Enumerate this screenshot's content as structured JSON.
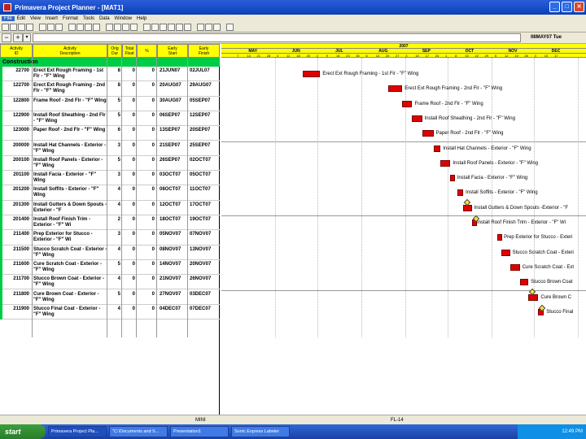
{
  "window": {
    "title": "Primavera Project Planner - [MAT1]",
    "min": "_",
    "max": "□",
    "close": "✕"
  },
  "menu": [
    "File",
    "Edit",
    "View",
    "Insert",
    "Format",
    "Tools",
    "Data",
    "Window",
    "Help"
  ],
  "editbar": {
    "minus": "−",
    "plus": "+",
    "arrow": "▾",
    "date": "08MAY07 Tue"
  },
  "columns": [
    {
      "label": "Activity\nID"
    },
    {
      "label": "Activity\nDescription"
    },
    {
      "label": "Orig\nDur"
    },
    {
      "label": "Total\nFloat"
    },
    {
      "label": "%"
    },
    {
      "label": "Early\nStart"
    },
    {
      "label": "Early\nFinish"
    }
  ],
  "wbs_group": "Construction",
  "activities": [
    {
      "id": "22700",
      "desc": "Erect Ext Rough Framing - 1st Flr - \"F\" Wing",
      "dur": "8",
      "tf": "0",
      "pct": "0",
      "es": "21JUN07",
      "ef": "02JUL07",
      "bar_label": "Erect Ext Rough Framing - 1st Flr - \"F\" Wing"
    },
    {
      "id": "122700",
      "desc": "Erect Ext Rough Framing - 2nd Flr - \"F\" Wing",
      "dur": "8",
      "tf": "0",
      "pct": "0",
      "es": "20AUG07",
      "ef": "29AUG07",
      "bar_label": "Erect Ext Rough Framing - 2nd Flr - \"F\" Wing"
    },
    {
      "id": "122800",
      "desc": "Frame Roof - 2nd Flr - \"F\" Wing",
      "dur": "5",
      "tf": "0",
      "pct": "0",
      "es": "30AUG07",
      "ef": "05SEP07",
      "bar_label": "Frame Roof - 2nd Flr - \"F\" Wing"
    },
    {
      "id": "122900",
      "desc": "Install Roof Sheathing - 2nd Flr - \"F\" Wing",
      "dur": "5",
      "tf": "0",
      "pct": "0",
      "es": "06SEP07",
      "ef": "12SEP07",
      "bar_label": "Install Roof Sheathing - 2nd Flr - \"F\" Wing"
    },
    {
      "id": "123000",
      "desc": "Paper Roof - 2nd Flr - \"F\" Wing",
      "dur": "6",
      "tf": "0",
      "pct": "0",
      "es": "13SEP07",
      "ef": "20SEP07",
      "bar_label": "Paper Roof - 2nd Flr - \"F\" Wing"
    },
    {
      "id": "200000",
      "desc": "Install Hat Channels - Exterior - \"F\" Wing",
      "dur": "3",
      "tf": "0",
      "pct": "0",
      "es": "21SEP07",
      "ef": "25SEP07",
      "bar_label": "Install Hat Channels - Exterior - \"F\" Wing"
    },
    {
      "id": "200100",
      "desc": "Install Roof Panels - Exterior - \"F\" Wing",
      "dur": "5",
      "tf": "0",
      "pct": "0",
      "es": "26SEP07",
      "ef": "02OCT07",
      "bar_label": "Install Roof Panels - Exterior - \"F\" Wing"
    },
    {
      "id": "201100",
      "desc": "Install Facia - Exterior - \"F\" Wing",
      "dur": "3",
      "tf": "0",
      "pct": "0",
      "es": "03OCT07",
      "ef": "05OCT07",
      "bar_label": "Install Facia - Exterior - \"F\" Wing"
    },
    {
      "id": "201200",
      "desc": "Install Soffits - Exterior - \"F\" Wing",
      "dur": "4",
      "tf": "0",
      "pct": "0",
      "es": "08OCT07",
      "ef": "11OCT07",
      "bar_label": "Install Soffits - Exterior - \"F\" Wing"
    },
    {
      "id": "201300",
      "desc": "Install Gutters & Down Spouts -Exterior - \"F",
      "dur": "4",
      "tf": "0",
      "pct": "0",
      "es": "12OCT07",
      "ef": "17OCT07",
      "bar_label": "Install Gutters & Down Spouts -Exterior - \"F"
    },
    {
      "id": "201400",
      "desc": "Install Roof Finish Trim - Exterior - \"F\" Wi",
      "dur": "2",
      "tf": "0",
      "pct": "0",
      "es": "18OCT07",
      "ef": "19OCT07",
      "bar_label": "Install Roof Finish Trim - Exterior - \"F\" Wi"
    },
    {
      "id": "211400",
      "desc": "Prep Exterior for Stucco - Exterior - \"F\" Wi",
      "dur": "3",
      "tf": "0",
      "pct": "0",
      "es": "05NOV07",
      "ef": "07NOV07",
      "bar_label": "Prep Exterior for Stucco - Exteri"
    },
    {
      "id": "211500",
      "desc": "Stucco Scratch Coat - Exterior - \"F\" Wing",
      "dur": "4",
      "tf": "0",
      "pct": "0",
      "es": "08NOV07",
      "ef": "13NOV07",
      "bar_label": "Stucco Scratch Coat - Exteri"
    },
    {
      "id": "211600",
      "desc": "Cure Scratch Coat - Exterior - \"F\" Wing",
      "dur": "5",
      "tf": "0",
      "pct": "0",
      "es": "14NOV07",
      "ef": "20NOV07",
      "bar_label": "Cure Scratch Coat - Ext"
    },
    {
      "id": "211700",
      "desc": "Stucco Brown Coat - Exterior - \"F\" Wing",
      "dur": "4",
      "tf": "0",
      "pct": "0",
      "es": "21NOV07",
      "ef": "26NOV07",
      "bar_label": "Stucco Brown Coat"
    },
    {
      "id": "211800",
      "desc": "Cure Brown Coat - Exterior - \"F\" Wing",
      "dur": "5",
      "tf": "0",
      "pct": "0",
      "es": "27NOV07",
      "ef": "03DEC07",
      "bar_label": "Cure Brown C"
    },
    {
      "id": "211900",
      "desc": "Stucco Final Coat - Exterior - \"F\" Wing",
      "dur": "4",
      "tf": "0",
      "pct": "0",
      "es": "04DEC07",
      "ef": "07DEC07",
      "bar_label": "Stucco Final"
    }
  ],
  "timescale": {
    "year": "2007",
    "months": [
      "MAY",
      "JUN",
      "JUL",
      "AUG",
      "SEP",
      "OCT",
      "NOV",
      "DEC"
    ],
    "days": [
      "7",
      "14",
      "21",
      "28",
      "4",
      "11",
      "18",
      "25",
      "2",
      "9",
      "16",
      "23",
      "30",
      "6",
      "13",
      "20",
      "27",
      "3",
      "10",
      "17",
      "24",
      "1",
      "8",
      "15",
      "22",
      "29",
      "5",
      "12",
      "19",
      "26",
      "3",
      "10",
      "17"
    ]
  },
  "status": {
    "left": "MINI",
    "right": "FL-14"
  },
  "taskbar": {
    "start": "start",
    "tasks": [
      "Primavera Project Pla...",
      "\"C:\\Documents and S...",
      "Presentation1",
      "Sonic Express Labeler"
    ],
    "clock": "12:49 PM"
  }
}
